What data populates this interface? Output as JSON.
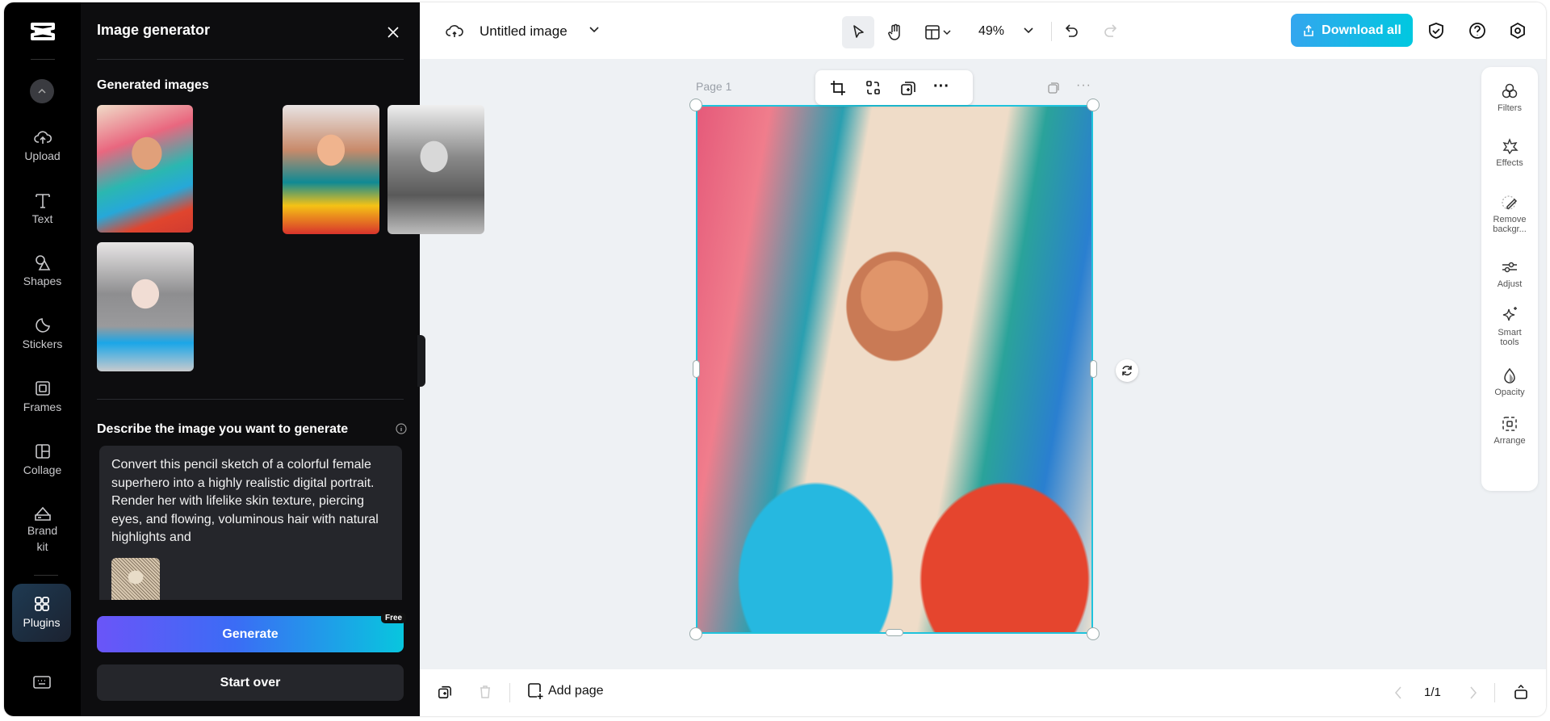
{
  "rail": {
    "items": [
      {
        "label": "Upload",
        "icon": "upload-cloud-icon"
      },
      {
        "label": "Text",
        "icon": "text-icon"
      },
      {
        "label": "Shapes",
        "icon": "shapes-icon"
      },
      {
        "label": "Stickers",
        "icon": "sticker-icon"
      },
      {
        "label": "Frames",
        "icon": "frame-icon"
      },
      {
        "label": "Collage",
        "icon": "collage-icon"
      },
      {
        "label": "Brand\nkit",
        "label_line1": "Brand",
        "label_line2": "kit",
        "icon": "brand-kit-icon"
      },
      {
        "label": "Plugins",
        "icon": "plugins-icon",
        "active": true
      }
    ]
  },
  "panel": {
    "title": "Image generator",
    "generated_heading": "Generated images",
    "generated_count": 4,
    "describe_label": "Describe the image you want to generate",
    "prompt": "Convert this pencil sketch of a colorful female superhero into a highly realistic digital portrait. Render her with lifelike skin texture, piercing eyes, and flowing, voluminous hair with natural highlights and",
    "generate_label": "Generate",
    "free_badge": "Free",
    "start_over_label": "Start over"
  },
  "topbar": {
    "doc_title": "Untitled image",
    "zoom": "49%",
    "download_label": "Download all",
    "accent": "#00c8e0"
  },
  "canvas": {
    "page_label": "Page 1"
  },
  "right_tools": [
    {
      "label": "Filters"
    },
    {
      "label": "Effects"
    },
    {
      "label": "Remove backgr..."
    },
    {
      "label": "Adjust"
    },
    {
      "label": "Smart tools"
    },
    {
      "label": "Opacity"
    },
    {
      "label": "Arrange"
    }
  ],
  "bottombar": {
    "add_page_label": "Add page",
    "page_indicator": "1/1"
  }
}
